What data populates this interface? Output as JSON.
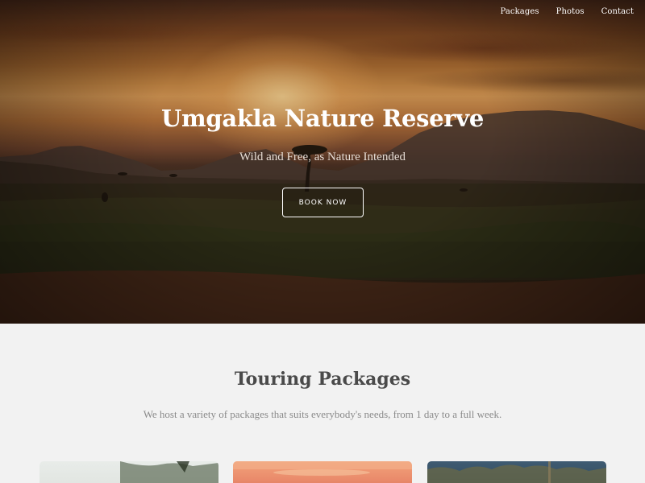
{
  "nav": {
    "items": [
      "Packages",
      "Photos",
      "Contact"
    ]
  },
  "hero": {
    "title": "Umgakla Nature Reserve",
    "subtitle": "Wild and Free, as Nature Intended",
    "cta_label": "BOOK NOW"
  },
  "packages": {
    "title": "Touring Packages",
    "description": "We host a variety of packages that suits everybody's needs, from 1 day to a full week."
  },
  "colors": {
    "page_background": "#f2f2f2",
    "heading": "#4a4a4a",
    "muted_text": "#8a8a8a",
    "hero_text": "#ffffff"
  }
}
